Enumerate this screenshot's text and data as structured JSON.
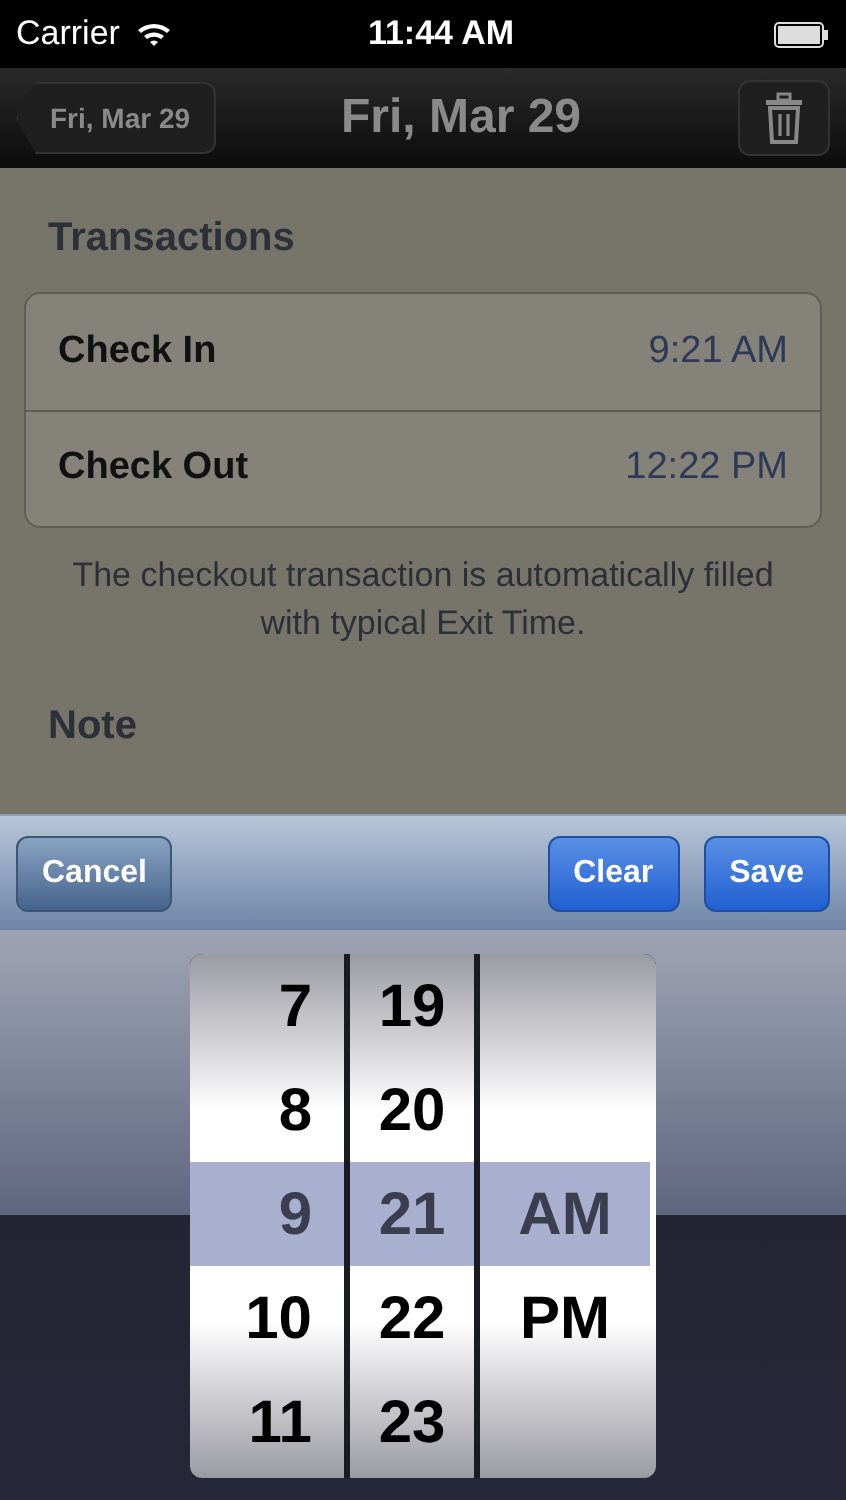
{
  "status_bar": {
    "carrier": "Carrier",
    "time": "11:44 AM"
  },
  "nav_bar": {
    "back": "Fri, Mar 29",
    "title": "Fri, Mar 29"
  },
  "sections": [
    {
      "header": "Transactions",
      "rows": [
        {
          "label": "Check In",
          "value": "9:21 AM"
        },
        {
          "label": "Check Out",
          "value": "12:22 PM"
        }
      ],
      "footer": "The checkout transaction is automatically filled with typical Exit Time."
    },
    {
      "header": "Note"
    }
  ],
  "toolbar": {
    "left": "Cancel",
    "right": [
      "Clear",
      "Save"
    ]
  },
  "picker": {
    "columns": [
      {
        "items": [
          {
            "text": "7",
            "selected": false
          },
          {
            "text": "8",
            "selected": false
          },
          {
            "text": "9",
            "selected": true
          },
          {
            "text": "10",
            "selected": false
          },
          {
            "text": "11",
            "selected": false
          }
        ]
      },
      {
        "items": [
          {
            "text": "19",
            "selected": false
          },
          {
            "text": "20",
            "selected": false
          },
          {
            "text": "21",
            "selected": true
          },
          {
            "text": "22",
            "selected": false
          },
          {
            "text": "23",
            "selected": false
          }
        ]
      },
      {
        "items": [
          {
            "text": "AM",
            "selected": true
          },
          {
            "text": "PM",
            "selected": false
          }
        ]
      }
    ]
  }
}
